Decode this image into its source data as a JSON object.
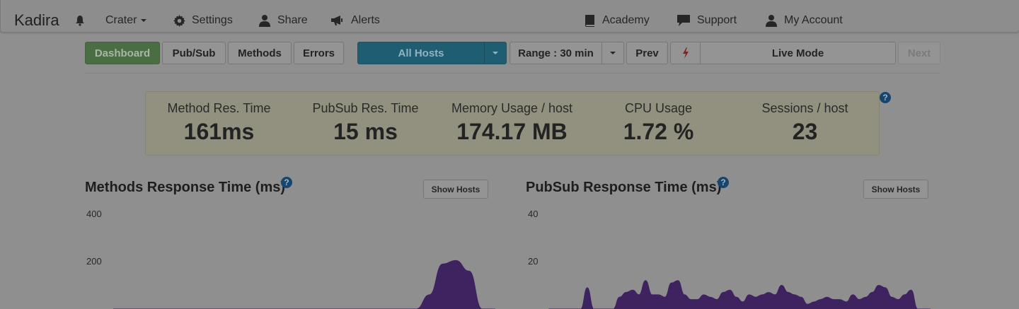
{
  "nav": {
    "brand": "Kadira",
    "app_menu": "Crater",
    "settings": "Settings",
    "share": "Share",
    "alerts": "Alerts",
    "academy": "Academy",
    "support": "Support",
    "account": "My Account"
  },
  "toolbar": {
    "tabs": [
      "Dashboard",
      "Pub/Sub",
      "Methods",
      "Errors"
    ],
    "host_select": "All Hosts",
    "range": "Range : 30 min",
    "prev": "Prev",
    "live": "Live Mode",
    "next": "Next"
  },
  "stats": [
    {
      "label": "Method Res. Time",
      "value": "161ms"
    },
    {
      "label": "PubSub Res. Time",
      "value": "15 ms"
    },
    {
      "label": "Memory Usage / host",
      "value": "174.17 MB"
    },
    {
      "label": "CPU Usage",
      "value": "1.72 %"
    },
    {
      "label": "Sessions / host",
      "value": "23"
    }
  ],
  "help_glyph": "?",
  "charts": {
    "methods": {
      "title": "Methods Response Time (ms)",
      "show_hosts": "Show Hosts",
      "ticks": [
        "400",
        "200"
      ]
    },
    "pubsub": {
      "title": "PubSub Response Time (ms)",
      "show_hosts": "Show Hosts",
      "ticks": [
        "40",
        "20"
      ]
    }
  },
  "colors": {
    "overlay_background": "#8f8f8f",
    "dashboard_tab": "#4b6d44",
    "host_select": "#1f5d73",
    "chart_series": "#3e2360",
    "live_icon": "#8a1e1e"
  },
  "chart_data": [
    {
      "type": "area",
      "title": "Methods Response Time (ms)",
      "ylim": [
        0,
        400
      ],
      "y_ticks": [
        400,
        200
      ],
      "x": [
        0,
        1,
        2,
        3,
        4,
        5,
        6,
        7,
        8,
        9,
        10,
        11,
        12,
        13,
        14,
        15,
        16,
        17,
        18,
        19,
        20,
        21,
        22,
        23,
        24,
        25,
        26,
        27,
        28,
        29
      ],
      "series": [
        {
          "values": [
            0,
            0,
            0,
            0,
            0,
            0,
            0,
            0,
            0,
            0,
            0,
            0,
            0,
            0,
            0,
            0,
            0,
            0,
            0,
            0,
            0,
            0,
            0,
            0,
            60,
            190,
            205,
            160,
            0,
            0
          ]
        }
      ]
    },
    {
      "type": "area",
      "title": "PubSub Response Time (ms)",
      "ylim": [
        0,
        40
      ],
      "y_ticks": [
        40,
        20
      ],
      "x": [
        0,
        1,
        2,
        3,
        4,
        5,
        6,
        7,
        8,
        9,
        10,
        11,
        12,
        13,
        14,
        15,
        16,
        17,
        18,
        19,
        20,
        21,
        22,
        23,
        24,
        25,
        26,
        27,
        28,
        29,
        30,
        31,
        32,
        33,
        34,
        35,
        36,
        37,
        38,
        39,
        40,
        41,
        42,
        43,
        44,
        45,
        46,
        47,
        48,
        49,
        50,
        51,
        52,
        53,
        54,
        55,
        56,
        57,
        58,
        59
      ],
      "series": [
        {
          "values": [
            0,
            0,
            0,
            0,
            0,
            0,
            9,
            0,
            0,
            0,
            0,
            5,
            7,
            8,
            6,
            12,
            6,
            6,
            5,
            11,
            12,
            6,
            4,
            4,
            6,
            5,
            4,
            7,
            8,
            5,
            3,
            6,
            5,
            6,
            7,
            6,
            10,
            7,
            6,
            5,
            2,
            3,
            4,
            5,
            4,
            4,
            3,
            6,
            4,
            5,
            7,
            10,
            9,
            5,
            4,
            6,
            8,
            0,
            0,
            0
          ]
        }
      ]
    }
  ]
}
